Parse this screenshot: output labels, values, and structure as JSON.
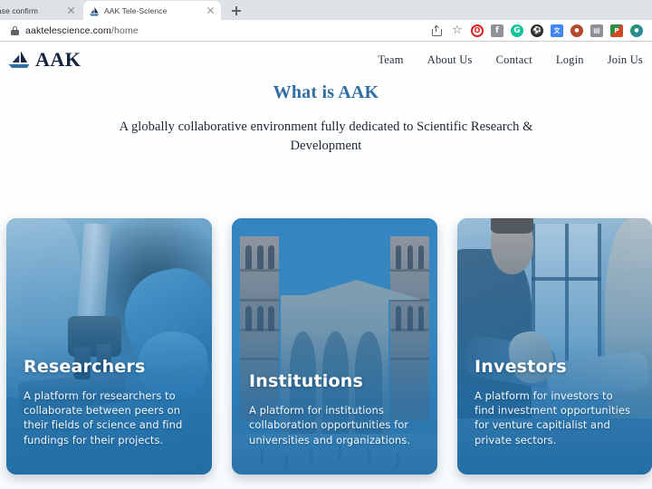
{
  "browser": {
    "tabs": [
      {
        "title": "ini please confirm",
        "active": false,
        "favicon": "none"
      },
      {
        "title": "AAK Tele-Science",
        "active": true,
        "favicon": "sailboat-icon"
      }
    ],
    "new_tab_label": "+",
    "address": {
      "host": "aaktelescience.com",
      "path": "/home",
      "security_icon": "lock-icon"
    },
    "omni_actions": [
      {
        "name": "share-icon",
        "label": "Share"
      },
      {
        "name": "bookmark-star-icon",
        "label": "Bookmark this tab",
        "glyph": "☆"
      }
    ],
    "extensions": [
      {
        "name": "opera-extension-icon",
        "glyph": "O",
        "color": "#ffffff",
        "bg": "#ffffff",
        "ring": "#e02020"
      },
      {
        "name": "facebook-extension-icon",
        "glyph": "f",
        "color": "#ffffff",
        "bg": "#8f9296"
      },
      {
        "name": "grammarly-extension-icon",
        "glyph": "G",
        "color": "#ffffff",
        "bg": "#15c39a"
      },
      {
        "name": "soccer-ball-extension-icon",
        "glyph": "⚽",
        "color": "#ffffff",
        "bg": "#2b2b2b"
      },
      {
        "name": "translate-extension-icon",
        "glyph": "文",
        "color": "#ffffff",
        "bg": "#4285f4"
      },
      {
        "name": "basketball-extension-icon",
        "glyph": "●",
        "color": "#ffffff",
        "bg": "#b44a2a"
      },
      {
        "name": "sidebar-extension-icon",
        "glyph": "▤",
        "color": "#ffffff",
        "bg": "#8d9196"
      },
      {
        "name": "powerpoint-extension-icon",
        "glyph": "P",
        "color": "#ffffff",
        "bg": "#d24726"
      },
      {
        "name": "globe-extension-icon",
        "glyph": "●",
        "color": "#ffffff",
        "bg": "#1f9d55"
      }
    ]
  },
  "site": {
    "brand": {
      "name": "AAK",
      "logo_icon": "sailboat-logo-icon"
    },
    "nav": [
      {
        "label": "Team"
      },
      {
        "label": "About Us"
      },
      {
        "label": "Contact"
      },
      {
        "label": "Login"
      },
      {
        "label": "Join Us"
      }
    ],
    "hero": {
      "title": "What is AAK",
      "subtitle": "A globally collaborative environment fully dedicated to Scientific Research & Development",
      "title_color": "#2f6ea5"
    },
    "cards": [
      {
        "title": "Researchers",
        "body": "A platform for researchers to collaborate between peers on their fields of science and find fundings for their projects.",
        "image_alt": "researcher-microscope-image"
      },
      {
        "title": "Institutions",
        "body": "A platform for institutions collaboration opportunities for universities and organizations.",
        "image_alt": "university-building-image"
      },
      {
        "title": "Investors",
        "body": "A platform for investors to find investment opportunities for venture capitialist and private sectors.",
        "image_alt": "handshake-investors-image"
      }
    ]
  }
}
